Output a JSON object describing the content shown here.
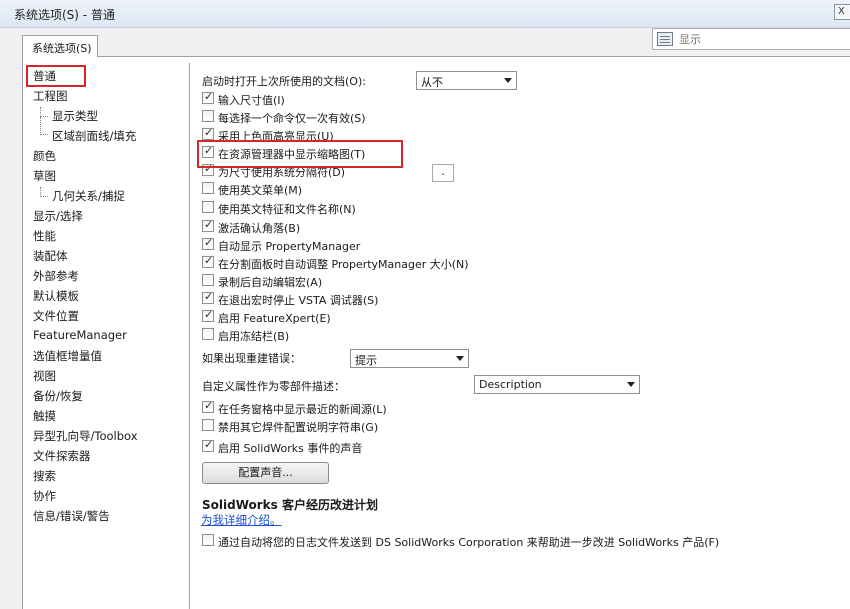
{
  "window": {
    "title": "系统选项(S) - 普通",
    "close_glyph": "X"
  },
  "tab": {
    "label": "系统选项(S)"
  },
  "search": {
    "placeholder": "显示"
  },
  "tree": {
    "items": [
      {
        "label": "普通"
      },
      {
        "label": "工程图"
      },
      {
        "label": "显示类型"
      },
      {
        "label": "区域剖面线/填充"
      },
      {
        "label": "颜色"
      },
      {
        "label": "草图"
      },
      {
        "label": "几何关系/捕捉"
      },
      {
        "label": "显示/选择"
      },
      {
        "label": "性能"
      },
      {
        "label": "装配体"
      },
      {
        "label": "外部参考"
      },
      {
        "label": "默认模板"
      },
      {
        "label": "文件位置"
      },
      {
        "label": "FeatureManager"
      },
      {
        "label": "选值框增量值"
      },
      {
        "label": "视图"
      },
      {
        "label": "备份/恢复"
      },
      {
        "label": "触摸"
      },
      {
        "label": "异型孔向导/Toolbox"
      },
      {
        "label": "文件探索器"
      },
      {
        "label": "搜索"
      },
      {
        "label": "协作"
      },
      {
        "label": "信息/错误/警告"
      }
    ]
  },
  "general": {
    "open_last_docs_label": "启动时打开上次所使用的文档(O):",
    "open_last_docs_value": "从不",
    "options": [
      {
        "label": "输入尺寸值(I)",
        "checked": true
      },
      {
        "label": "每选择一个命令仅一次有效(S)",
        "checked": false
      },
      {
        "label": "采用上色面高亮显示(U)",
        "checked": true
      },
      {
        "label": "在资源管理器中显示缩略图(T)",
        "checked": true
      },
      {
        "label": "为尺寸使用系统分隔符(D)",
        "checked": true
      },
      {
        "label": "使用英文菜单(M)",
        "checked": false
      },
      {
        "label": "使用英文特征和文件名称(N)",
        "checked": false
      },
      {
        "label": "激活确认角落(B)",
        "checked": true
      },
      {
        "label": "自动显示 PropertyManager",
        "checked": true
      },
      {
        "label": "在分割面板时自动调整 PropertyManager 大小(N)",
        "checked": true
      },
      {
        "label": "录制后自动编辑宏(A)",
        "checked": false
      },
      {
        "label": "在退出宏时停止 VSTA 调试器(S)",
        "checked": true
      },
      {
        "label": "启用 FeatureXpert(E)",
        "checked": true
      },
      {
        "label": "启用冻结栏(B)",
        "checked": false
      }
    ],
    "separator_value": ".",
    "rebuild_error_label": "如果出现重建错误：",
    "rebuild_error_value": "提示",
    "custom_prop_label": "自定义属性作为零部件描述：",
    "custom_prop_value": "Description",
    "options2": [
      {
        "label": "在任务窗格中显示最近的新闻源(L)",
        "checked": true
      },
      {
        "label": "禁用其它焊件配置说明字符串(G)",
        "checked": false
      },
      {
        "label": "启用 SolidWorks 事件的声音",
        "checked": true
      }
    ],
    "config_sound_button": "配置声音...",
    "ceip_title": "SolidWorks 客户经历改进计划",
    "ceip_link": "为我详细介绍。",
    "ceip_option": {
      "label": "通过自动将您的日志文件发送到 DS SolidWorks Corporation 来帮助进一步改进 SolidWorks 产品(F)",
      "checked": false
    }
  }
}
